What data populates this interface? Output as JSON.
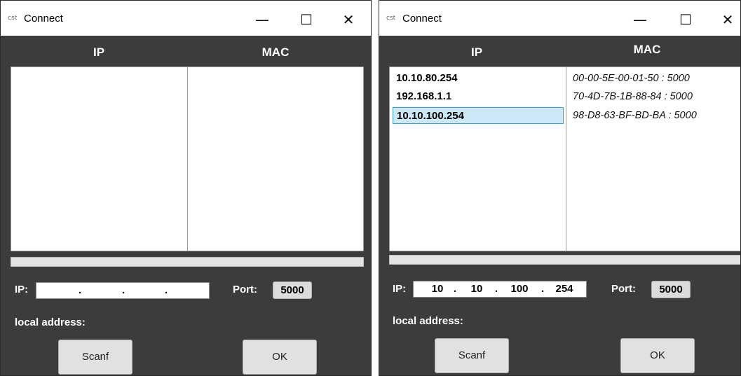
{
  "windows": [
    {
      "title": "Connect",
      "title_icon": "cst",
      "columns": {
        "ip": "IP",
        "mac": "MAC"
      },
      "ip_list": [],
      "mac_list": [],
      "ip_label": "IP:",
      "ip_octets": [
        "",
        "",
        "",
        ""
      ],
      "ip_dot": ".",
      "port_label": "Port:",
      "port_value": "5000",
      "local_address_label": "local address:",
      "scan_button": "Scanf",
      "ok_button": "OK"
    },
    {
      "title": "Connect",
      "title_icon": "cst",
      "columns": {
        "ip": "IP",
        "mac": "MAC"
      },
      "ip_list": [
        "10.10.80.254",
        "192.168.1.1",
        "10.10.100.254"
      ],
      "selected_index": 2,
      "mac_list": [
        "00-00-5E-00-01-50 : 5000",
        "70-4D-7B-1B-88-84 : 5000",
        "98-D8-63-BF-BD-BA : 5000"
      ],
      "ip_label": "IP:",
      "ip_octets": [
        "10",
        "10",
        "100",
        "254"
      ],
      "ip_dot": ".",
      "port_label": "Port:",
      "port_value": "5000",
      "local_address_label": "local address:",
      "scan_button": "Scanf",
      "ok_button": "OK"
    }
  ],
  "title_buttons": {
    "minimize": "—",
    "maximize": "☐",
    "close": "✕"
  },
  "colors": {
    "window_bg": "#3c3c3c",
    "selection_bg": "#cce8f6",
    "selection_border": "#3c9fd6"
  }
}
